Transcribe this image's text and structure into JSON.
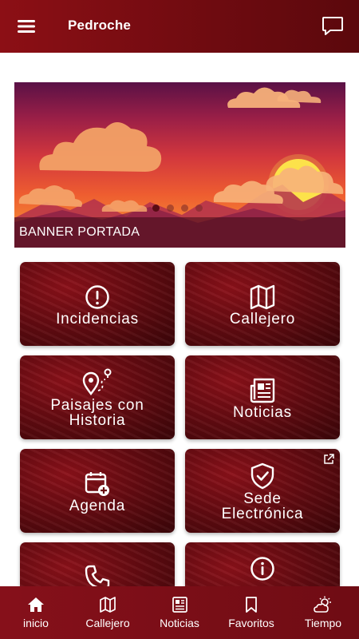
{
  "header": {
    "title": "Pedroche",
    "menu_icon": "hamburger-menu-icon",
    "chat_icon": "chat-bubble-icon"
  },
  "banner": {
    "caption": "BANNER PORTADA",
    "slides": 4,
    "active_slide": 1
  },
  "tiles": [
    {
      "label": "Incidencias",
      "icon": "alert-circle-icon"
    },
    {
      "label": "Callejero",
      "icon": "map-icon"
    },
    {
      "label_line1": "Paisajes con",
      "label_line2": "Historia",
      "icon": "route-pin-icon"
    },
    {
      "label": "Noticias",
      "icon": "newspaper-icon"
    },
    {
      "label": "Agenda",
      "icon": "calendar-add-icon"
    },
    {
      "label_line1": "Sede",
      "label_line2": "Electrónica",
      "icon": "shield-check-icon",
      "external_icon": "external-link-icon"
    },
    {
      "label": "",
      "icon": "phone-icon"
    },
    {
      "label": "",
      "icon": "info-circle-icon"
    }
  ],
  "bottom_nav": [
    {
      "label": "inicio",
      "icon": "home-icon",
      "active": true
    },
    {
      "label": "Callejero",
      "icon": "map-icon"
    },
    {
      "label": "Noticias",
      "icon": "newspaper-icon"
    },
    {
      "label": "Favoritos",
      "icon": "bookmark-icon"
    },
    {
      "label": "Tiempo",
      "icon": "weather-icon"
    }
  ],
  "colors": {
    "primary": "#7a0c12",
    "header": "#8c0f15",
    "tile_dark": "#5e0a10",
    "white": "#ffffff"
  }
}
